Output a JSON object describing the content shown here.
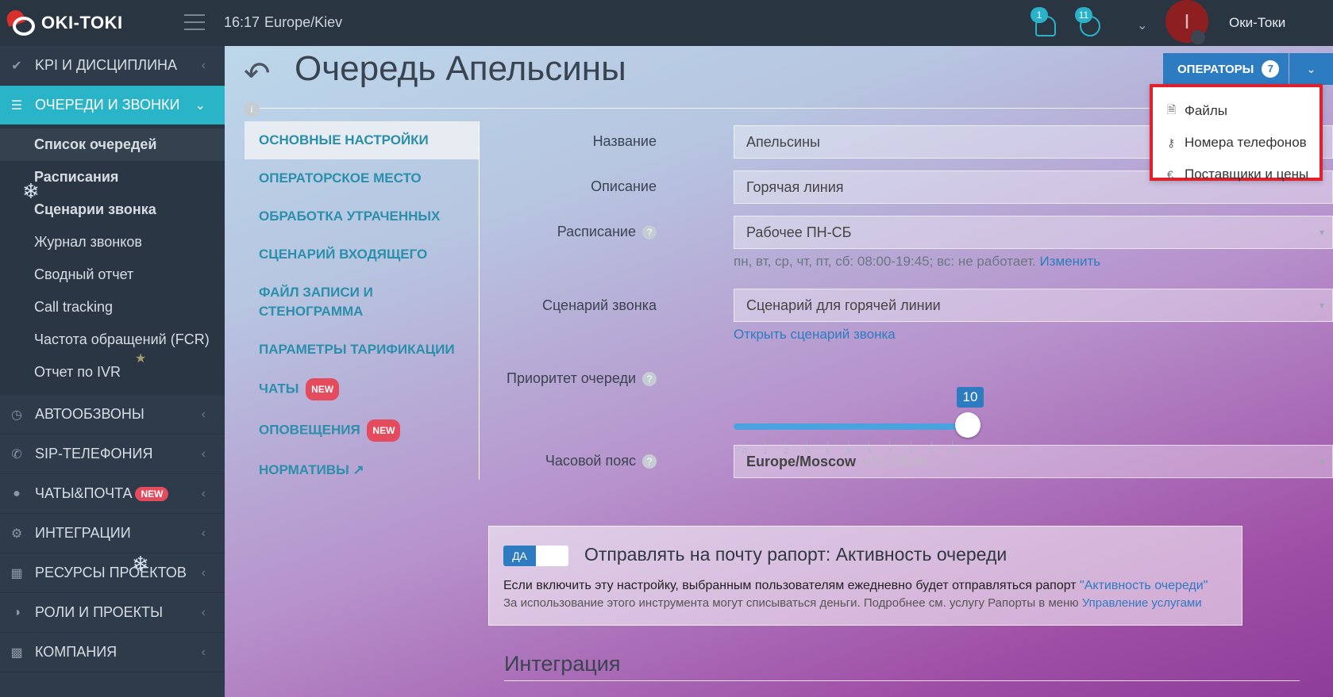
{
  "header": {
    "logo_text": "OKI-TOKI",
    "time": "16:17",
    "timezone": "Europe/Kiev",
    "notifications_count": "1",
    "calls_count": "11",
    "avatar_letter": "I",
    "user_name": "Оки-Токи"
  },
  "sidebar": {
    "items": [
      {
        "label": "KPI И ДИСЦИПЛИНА",
        "icon": "check-icon"
      },
      {
        "label": "ОЧЕРЕДИ И ЗВОНКИ",
        "icon": "list-icon"
      },
      {
        "label": "АВТООБЗВОНЫ",
        "icon": "clock-icon"
      },
      {
        "label": "SIP-ТЕЛЕФОНИЯ",
        "icon": "phone-icon"
      },
      {
        "label": "ЧАТЫ&ПОЧТА",
        "icon": "chat-icon",
        "badge": "NEW"
      },
      {
        "label": "ИНТЕГРАЦИИ",
        "icon": "gears-icon"
      },
      {
        "label": "РЕСУРСЫ ПРОЕКТОВ",
        "icon": "grid-icon"
      },
      {
        "label": "РОЛИ И ПРОЕКТЫ",
        "icon": "toggle-icon"
      },
      {
        "label": "КОМПАНИЯ",
        "icon": "bar-chart-icon"
      }
    ],
    "subitems": [
      "Список очередей",
      "Расписания",
      "Сценарии звонка",
      "Журнал звонков",
      "Сводный отчет",
      "Call tracking",
      "Частота обращений (FCR)",
      "Отчет по IVR"
    ]
  },
  "page": {
    "title": "Очередь Апельсины",
    "operators_label": "ОПЕРАТОРЫ",
    "operators_count": "7",
    "info_mark": "i"
  },
  "dropdown": {
    "items": [
      {
        "label": "Файлы",
        "icon": "file-icon"
      },
      {
        "label": "Номера телефонов",
        "icon": "key-icon"
      },
      {
        "label": "Поставщики и цены",
        "icon": "euro-icon"
      }
    ]
  },
  "settings_nav": {
    "items": [
      {
        "label": "ОСНОВНЫЕ НАСТРОЙКИ"
      },
      {
        "label": "ОПЕРАТОРСКОЕ МЕСТО"
      },
      {
        "label": "ОБРАБОТКА УТРАЧЕННЫХ"
      },
      {
        "label": "СЦЕНАРИЙ ВХОДЯЩЕГО"
      },
      {
        "label": "ФАЙЛ ЗАПИСИ И СТЕНОГРАММА"
      },
      {
        "label": "ПАРАМЕТРЫ ТАРИФИКАЦИИ"
      },
      {
        "label": "ЧАТЫ",
        "badge": "NEW"
      },
      {
        "label": "ОПОВЕЩЕНИЯ",
        "badge": "NEW"
      },
      {
        "label": "НОРМАТИВЫ",
        "external_icon": "external-link-icon"
      }
    ]
  },
  "form": {
    "name_label": "Название",
    "name_value": "Апельсины",
    "desc_label": "Описание",
    "desc_value": "Горячая линия",
    "schedule_label": "Расписание",
    "schedule_value": "Рабочее ПН-СБ",
    "schedule_hint": "пн, вт, ср, чт, пт, сб: 08:00-19:45; вс: не работает.",
    "schedule_change": "Изменить",
    "scenario_label": "Сценарий звонка",
    "scenario_value": "Сценарий для горячей линии",
    "scenario_link": "Открыть сценарий звонка",
    "priority_label": "Приоритет очереди",
    "priority_value": "10",
    "priority_min": 0,
    "priority_max": 10,
    "priority_ticks": [
      "0",
      "1",
      "2",
      "3",
      "4",
      "5",
      "6",
      "7",
      "8",
      "9",
      "10"
    ],
    "timezone_label": "Часовой пояс",
    "timezone_value": "Europe/Moscow",
    "timezone_extra": "UTC +03:00",
    "help_mark": "?"
  },
  "report": {
    "toggle_label": "ДА",
    "title": "Отправлять на почту рапорт: Активность очереди",
    "text": "Если включить эту настройку, выбранным пользователям ежедневно будет отправляться рапорт",
    "text_link": "\"Активность очереди\"",
    "small": "За использование этого инструмента могут списываться деньги. Подробнее см. услугу Рапорты в меню",
    "small_link": "Управление услугами"
  },
  "integration": {
    "title": "Интеграция"
  },
  "colors": {
    "accent": "#2ab4c8",
    "primary": "#2d7bc0",
    "sidebar": "#2e3b4a",
    "highlight_border": "#e0202a",
    "badge": "#e44b5c"
  }
}
